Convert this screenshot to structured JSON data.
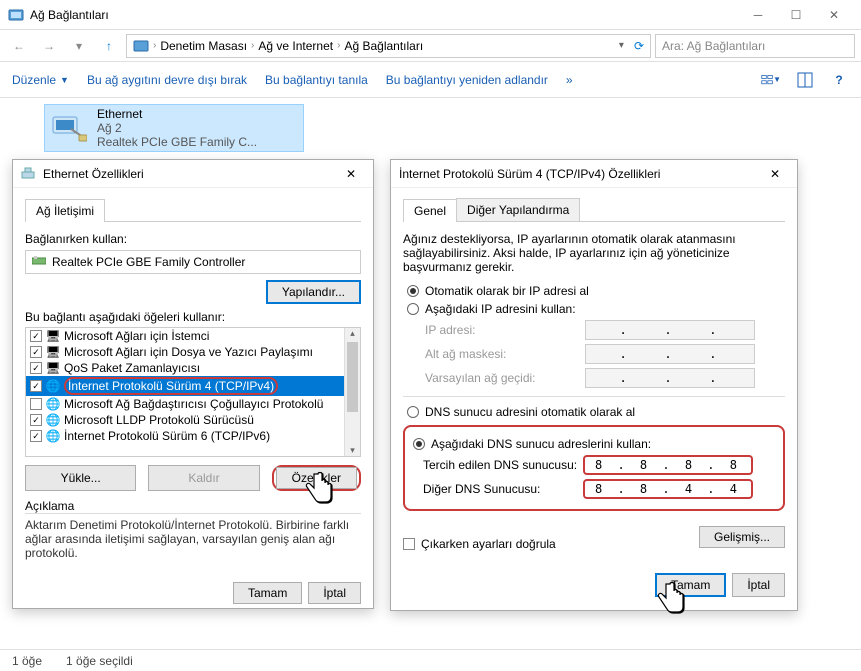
{
  "window": {
    "title": "Ağ Bağlantıları"
  },
  "breadcrumb": {
    "items": [
      "Denetim Masası",
      "Ağ ve Internet",
      "Ağ Bağlantıları"
    ]
  },
  "search": {
    "placeholder": "Ara: Ağ Bağlantıları"
  },
  "toolbar": {
    "organize": "Düzenle",
    "disable": "Bu ağ aygıtını devre dışı bırak",
    "diagnose": "Bu bağlantıyı tanıla",
    "rename": "Bu bağlantıyı yeniden adlandır",
    "more": "»"
  },
  "adapter": {
    "name": "Ethernet",
    "network": "Ağ  2",
    "device": "Realtek PCIe GBE Family C..."
  },
  "eth_dialog": {
    "title": "Ethernet Özellikleri",
    "tab_networking": "Ağ İletişimi",
    "connect_using_label": "Bağlanırken kullan:",
    "device": "Realtek PCIe GBE Family Controller",
    "configure": "Yapılandır...",
    "uses_items_label": "Bu bağlantı aşağıdaki öğeleri kullanır:",
    "items": [
      {
        "label": "Microsoft Ağları için İstemci",
        "checked": true
      },
      {
        "label": "Microsoft Ağları için Dosya ve Yazıcı Paylaşımı",
        "checked": true
      },
      {
        "label": "QoS Paket Zamanlayıcısı",
        "checked": true
      },
      {
        "label": "İnternet Protokolü Sürüm 4 (TCP/IPv4)",
        "checked": true,
        "selected": true
      },
      {
        "label": "Microsoft Ağ Bağdaştırıcısı Çoğullayıcı Protokolü",
        "checked": false
      },
      {
        "label": "Microsoft LLDP Protokolü Sürücüsü",
        "checked": true
      },
      {
        "label": "İnternet Protokolü Sürüm 6 (TCP/IPv6)",
        "checked": true
      }
    ],
    "install": "Yükle...",
    "uninstall": "Kaldır",
    "properties": "Özellikler",
    "desc_heading": "Açıklama",
    "desc_text": "Aktarım Denetimi Protokolü/İnternet Protokolü. Birbirine farklı ağlar arasında iletişimi sağlayan, varsayılan geniş alan ağı protokolü.",
    "ok": "Tamam",
    "cancel": "İptal"
  },
  "ipv4_dialog": {
    "title": "İnternet Protokolü Sürüm 4 (TCP/IPv4) Özellikleri",
    "tab_general": "Genel",
    "tab_alt": "Diğer Yapılandırma",
    "intro": "Ağınız destekliyorsa, IP ayarlarının otomatik olarak atanmasını sağlayabilirsiniz. Aksi halde, IP ayarlarınız için ağ yöneticinize başvurmanız gerekir.",
    "radio_auto_ip": "Otomatik olarak bir IP adresi al",
    "radio_static_ip": "Aşağıdaki IP adresini kullan:",
    "ip_address": "IP adresi:",
    "subnet": "Alt ağ maskesi:",
    "gateway": "Varsayılan ağ geçidi:",
    "radio_auto_dns": "DNS sunucu adresini otomatik olarak al",
    "radio_static_dns": "Aşağıdaki DNS sunucu adreslerini kullan:",
    "dns_preferred": "Tercih edilen DNS sunucusu:",
    "dns_alt": "Diğer DNS Sunucusu:",
    "dns1": "8 . 8 . 8 . 8",
    "dns2": "8 . 8 . 4 . 4",
    "validate": "Çıkarken ayarları doğrula",
    "advanced": "Gelişmiş...",
    "ok": "Tamam",
    "cancel": "İptal"
  },
  "statusbar": {
    "count": "1 öğe",
    "selected": "1 öğe seçildi"
  }
}
